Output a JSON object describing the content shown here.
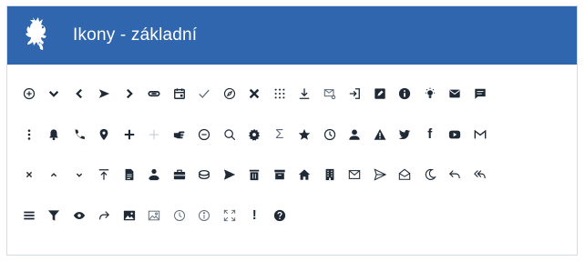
{
  "header": {
    "title": "Ikony - základní",
    "logo_icon": "lion-coat-of-arms",
    "background": "#2f66ad"
  },
  "icons": {
    "rows": [
      [
        "plus-circle-icon",
        "chevron-down-icon",
        "chevron-left-icon",
        "arrow-right-icon",
        "chevron-right-icon",
        "link-icon",
        "calendar-icon",
        "check-icon",
        "compass-icon",
        "close-icon",
        "apps-icon",
        "download-icon",
        "mail-attachment-icon",
        "sign-in-icon",
        "edit-square-icon",
        "info-circle-icon",
        "lightbulb-icon",
        "envelope-icon",
        "comment-icon"
      ],
      [
        "more-vertical-icon",
        "bell-icon",
        "phone-icon",
        "map-marker-icon",
        "plus-icon",
        "plus-thin-icon",
        "hand-right-icon",
        "minus-circle-icon",
        "search-icon",
        "gear-icon",
        "sigma-icon",
        "star-icon",
        "clock-icon",
        "user-icon",
        "warning-icon",
        "twitter-icon",
        "facebook-icon",
        "youtube-icon",
        "gmail-icon"
      ],
      [
        "close-small-icon",
        "chevron-up-small-icon",
        "chevron-down-small-icon",
        "upload-icon",
        "document-icon",
        "user-group-icon",
        "briefcase-icon",
        "coin-icon",
        "send-icon",
        "trash-icon",
        "archive-icon",
        "home-icon",
        "building-icon",
        "mail-outline-icon",
        "send-outline-icon",
        "mail-open-icon",
        "moon-icon",
        "reply-icon",
        "reply-all-icon"
      ],
      [
        "menu-icon",
        "filter-icon",
        "eye-icon",
        "share-arrow-icon",
        "image-icon",
        "image-outline-icon",
        "clock-outline-icon",
        "info-outline-icon",
        "fullscreen-icon",
        "exclamation-icon",
        "question-circle-icon"
      ]
    ],
    "labels": {
      "sigma": "Σ",
      "facebook": "f",
      "exclamation": "!"
    }
  }
}
